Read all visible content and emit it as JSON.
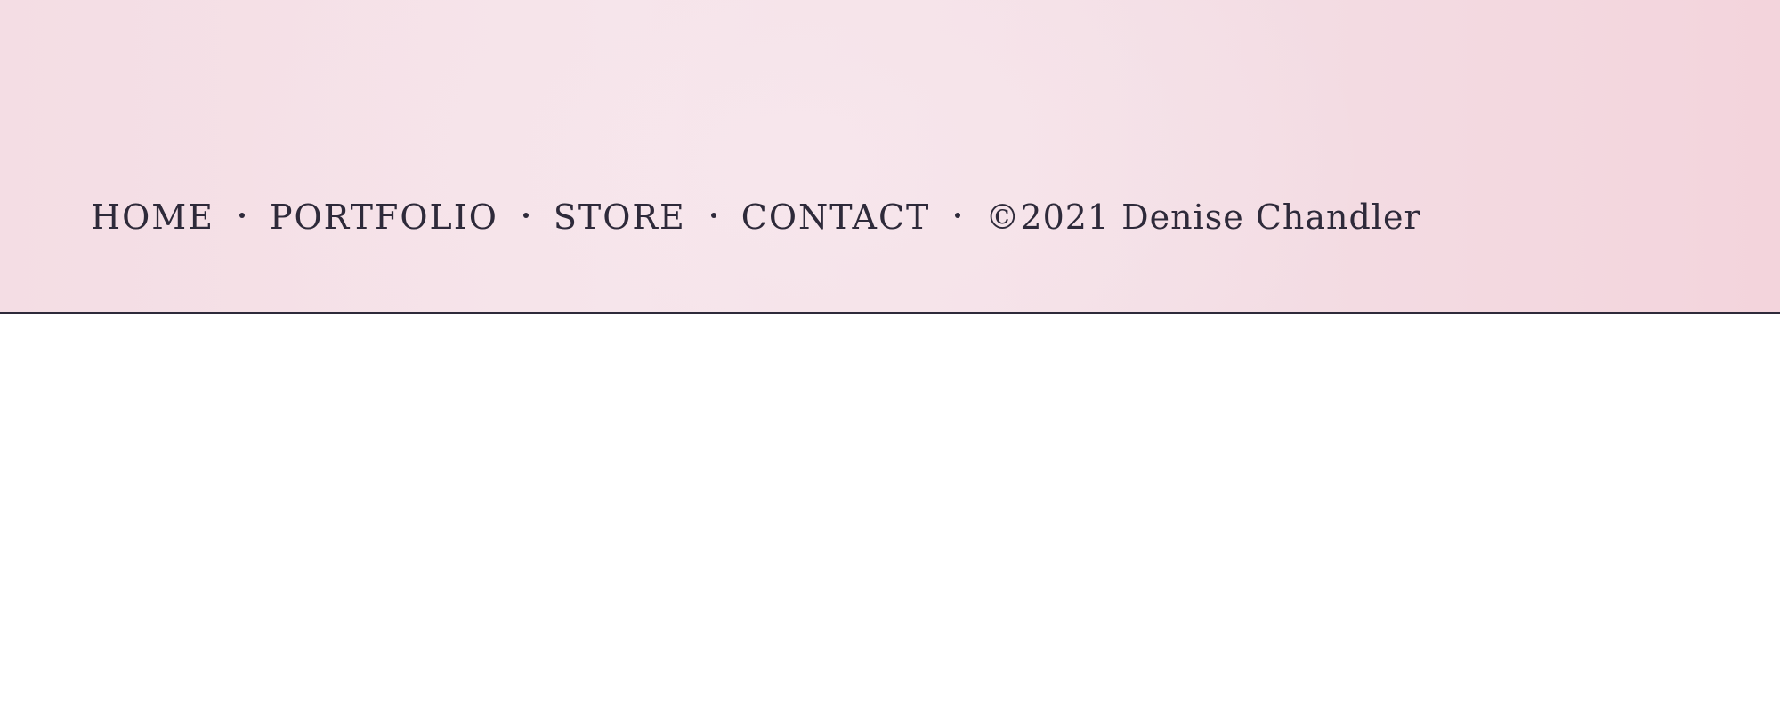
{
  "footer": {
    "nav": [
      {
        "label": "HOME"
      },
      {
        "label": "PORTFOLIO"
      },
      {
        "label": "STORE"
      },
      {
        "label": "CONTACT"
      }
    ],
    "copyright": "©2021 Denise Chandler"
  },
  "colors": {
    "background": "#f5e1e8",
    "text": "#2e2a3a",
    "rule": "#2e2a3a",
    "page": "#ffffff"
  }
}
